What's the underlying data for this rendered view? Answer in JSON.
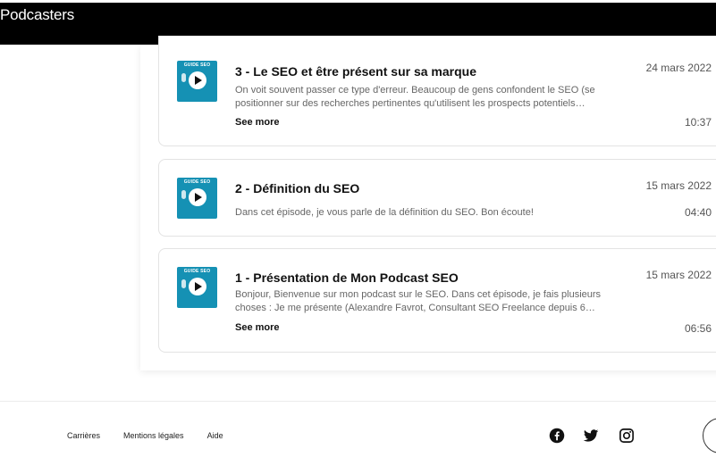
{
  "header": {
    "brand": "Podcasters"
  },
  "episodes": [
    {
      "title": "3 - Le SEO et être présent sur sa marque",
      "date": "24 mars 2022",
      "description": "On voit souvent passer ce type d'erreur. Beaucoup de gens confondent le SEO (se positionner sur des recherches pertinentes qu'utilisent les prospects potentiels…",
      "see_more": "See more",
      "duration": "10:37",
      "thumb_label": "GUIDE SEO"
    },
    {
      "title": "2 - Définition du SEO",
      "date": "15 mars 2022",
      "description": "Dans cet épisode, je vous parle de la définition du SEO. Bon écoute!",
      "duration": "04:40",
      "thumb_label": "GUIDE SEO"
    },
    {
      "title": "1 - Présentation de Mon Podcast SEO",
      "date": "15 mars 2022",
      "description": "Bonjour, Bienvenue sur mon podcast sur le SEO.  Dans cet épisode, je fais plusieurs choses :  Je me présente (Alexandre Favrot, Consultant SEO Freelance depuis 6…",
      "see_more": "See more",
      "duration": "06:56",
      "thumb_label": "GUIDE SEO"
    }
  ],
  "footer": {
    "links": [
      "Carrières",
      "Mentions légales",
      "Aide"
    ],
    "social_icons": [
      "facebook-icon",
      "twitter-icon",
      "instagram-icon"
    ]
  },
  "colors": {
    "header_bg": "#000000",
    "thumb_bg": "#1591b4"
  }
}
